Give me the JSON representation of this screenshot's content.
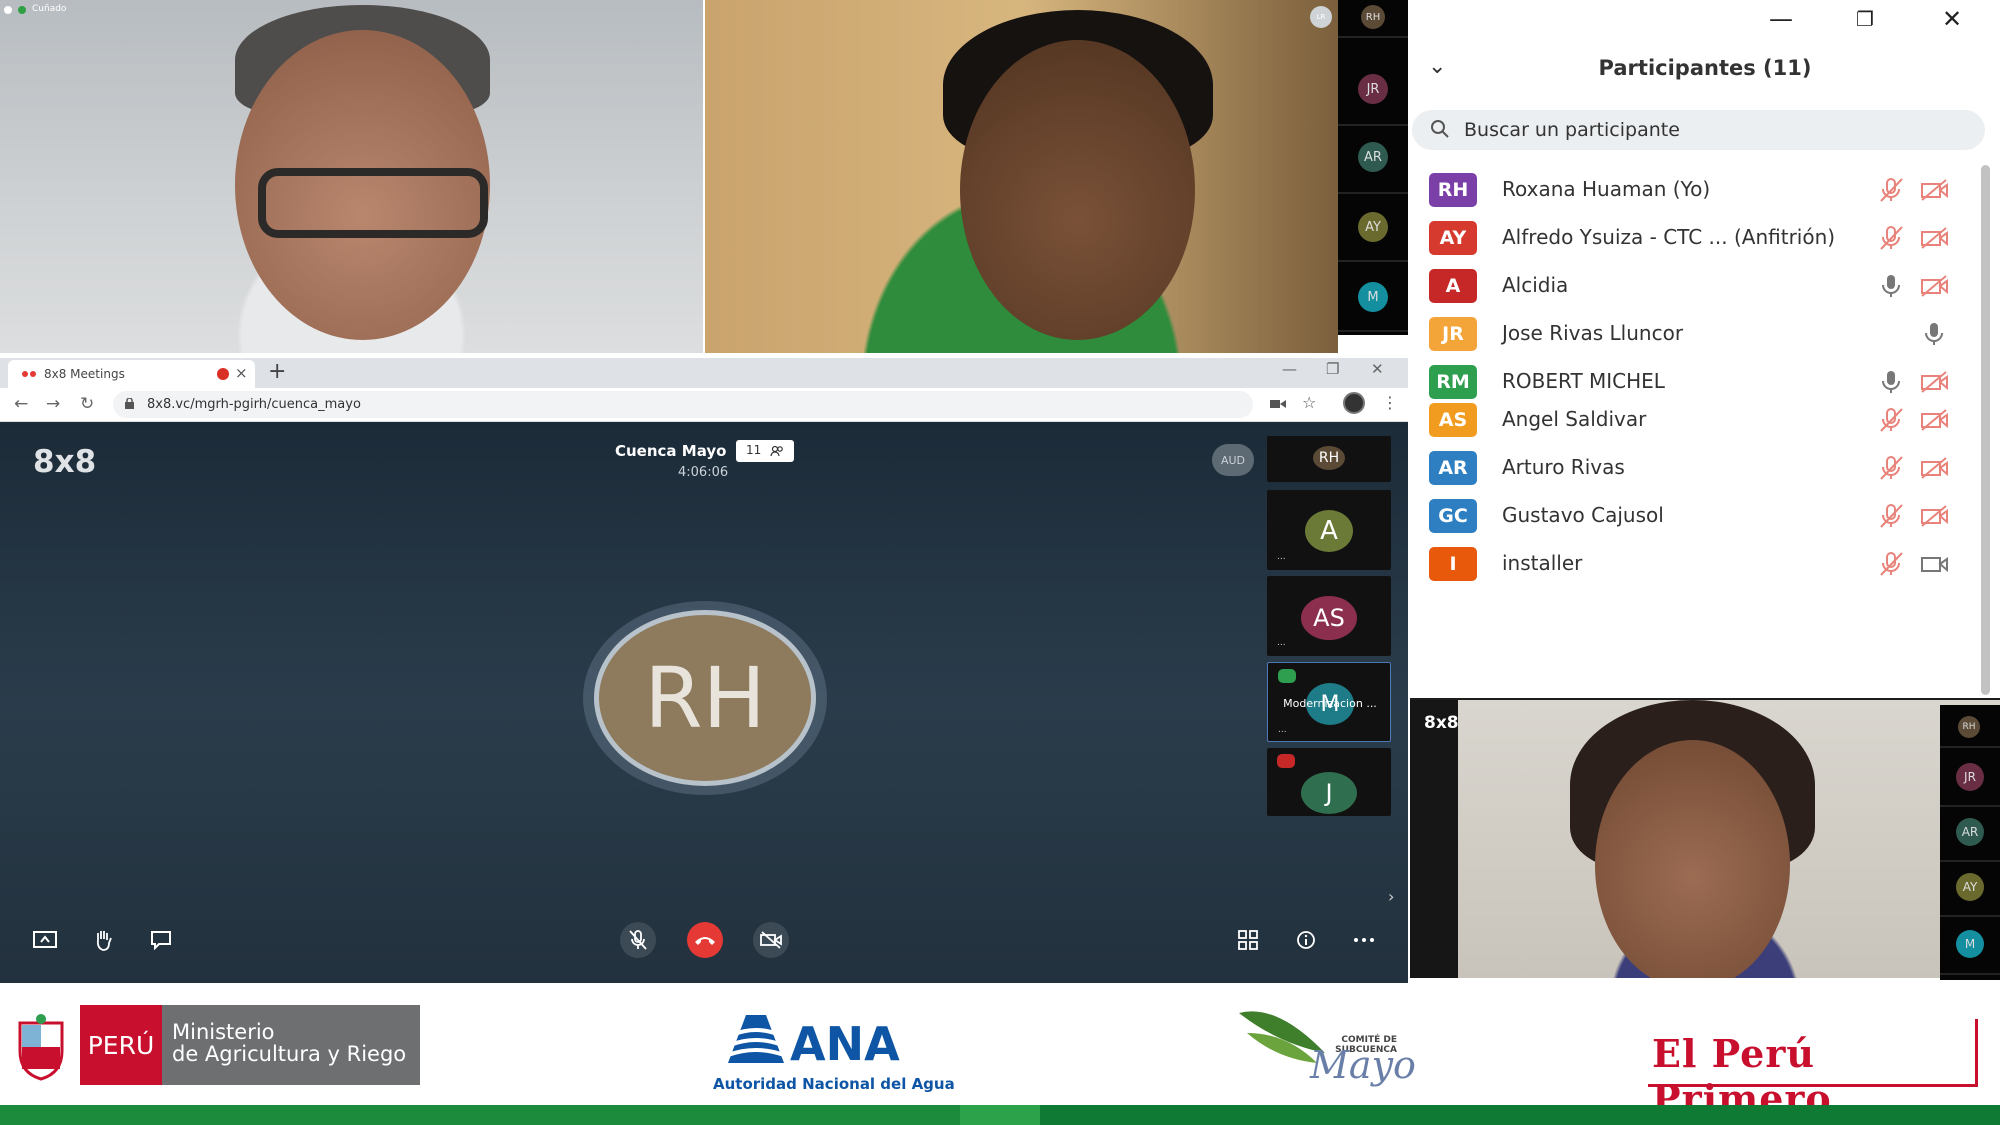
{
  "colors": {
    "accent_red": "#e53935",
    "panel_text": "#333333",
    "meeting_bg": "#223140"
  },
  "top_left_video": {
    "label": "Cuñado"
  },
  "top_right_video": {
    "tag": "LR"
  },
  "thumbs_top": [
    "RH",
    "JR",
    "AR",
    "AY",
    "M"
  ],
  "thumbs_bottom": [
    "RH",
    "JR",
    "AR",
    "AY",
    "M"
  ],
  "window_controls": {
    "minimize": "—",
    "restore": "❐",
    "close": "✕"
  },
  "participants": {
    "title": "Participantes (11)",
    "search_placeholder": "Buscar un participante",
    "items": [
      {
        "initials": "RH",
        "name": "Roxana Huaman (Yo)",
        "color": "#7b3fa8",
        "mic": "muted",
        "cam": "off"
      },
      {
        "initials": "AY",
        "name": "Alfredo Ysuiza - CTC ...  (Anfitrión)",
        "color": "#d63a2f",
        "mic": "muted",
        "cam": "off"
      },
      {
        "initials": "A",
        "name": "Alcidia",
        "color": "#c62828",
        "mic": "on",
        "cam": "off"
      },
      {
        "initials": "JR",
        "name": "Jose Rivas Lluncor",
        "color": "#f4a53a",
        "mic": "on",
        "cam": "none"
      },
      {
        "initials": "RM",
        "name": "ROBERT MICHEL",
        "color": "#2e9e4f",
        "mic": "on",
        "cam": "off"
      },
      {
        "initials": "AS",
        "name": "Angel Saldivar",
        "color": "#f29c1f",
        "mic": "muted",
        "cam": "off"
      },
      {
        "initials": "AR",
        "name": "Arturo Rivas",
        "color": "#2d7fc1",
        "mic": "muted",
        "cam": "off"
      },
      {
        "initials": "GC",
        "name": "Gustavo Cajusol",
        "color": "#2d7fc1",
        "mic": "muted",
        "cam": "off"
      },
      {
        "initials": "I",
        "name": "installer",
        "color": "#e8590c",
        "mic": "muted",
        "cam": "on"
      }
    ]
  },
  "bottom_video": {
    "brand": "8x8"
  },
  "browser": {
    "tab_title": "8x8 Meetings",
    "tab_close": "×",
    "new_tab": "+",
    "url": "8x8.vc/mgrh-pgirh/cuenca_mayo",
    "nav_back": "←",
    "nav_forward": "→",
    "nav_reload": "↻",
    "bookmark": "☆",
    "menu": "⋮"
  },
  "meeting": {
    "brand": "8x8",
    "title": "Cuenca Mayo",
    "participant_count": "11",
    "elapsed": "4:06:06",
    "aud_badge": "AUD",
    "dominant_initials": "RH",
    "thumbnails": [
      {
        "initials": "RH",
        "color": "#5b4a36"
      },
      {
        "initials": "A",
        "color": "#6b7a36"
      },
      {
        "initials": "AS",
        "color": "#8c2f4f"
      },
      {
        "initials": "M",
        "color": "#1e7b88",
        "label": "Modernizacion ..."
      },
      {
        "initials": "J",
        "color": "#2f6e4f"
      }
    ],
    "dots": "..."
  },
  "banner": {
    "peru": "PERÚ",
    "ministry_line1": "Ministerio",
    "ministry_line2": "de Agricultura y Riego",
    "ana": "ANA",
    "ana_sub": "Autoridad Nacional del Agua",
    "comite": "COMITÉ DE SUBCUENCA",
    "mayo": "Mayo",
    "el_peru_primero": "El Perú Primero"
  }
}
